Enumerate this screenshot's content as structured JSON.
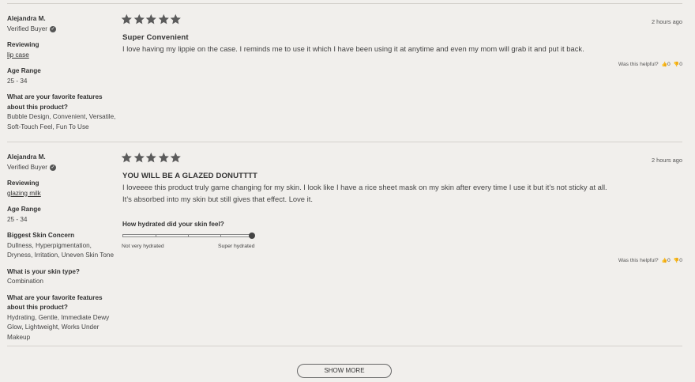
{
  "reviews": [
    {
      "author": "Alejandra M.",
      "badge": "Verified Buyer",
      "rating": 5,
      "date": "2 hours ago",
      "title": "Super Convenient",
      "body_lines": [
        "I love having my lippie on the case. I reminds me to use it which I have been using it at anytime and even my mom will grab it and put it back."
      ],
      "reviewing_label": "Reviewing",
      "reviewing": "lip case",
      "age_label": "Age Range",
      "age": "25 - 34",
      "features_label_lines": [
        "What are your favorite features",
        "about this product?"
      ],
      "features_lines": [
        "Bubble Design, Convenient, Versatile,",
        "Soft-Touch Feel, Fun To Use"
      ],
      "helpful_label": "Was this helpful?",
      "helpful_yes": "0",
      "helpful_no": "0"
    },
    {
      "author": "Alejandra M.",
      "badge": "Verified Buyer",
      "rating": 5,
      "date": "2 hours ago",
      "title": "YOU WILL BE A GLAZED DONUTTTT",
      "body_lines": [
        "I loveeee this product truly game changing for my skin. I look like I have a rice sheet mask on my skin after every time I use it but it’s not sticky at all.",
        "It’s absorbed into my skin but still gives that effect. Love it."
      ],
      "reviewing_label": "Reviewing",
      "reviewing": "glazing milk",
      "age_label": "Age Range",
      "age": "25 - 34",
      "concern_label": "Biggest Skin Concern",
      "concern_lines": [
        "Dullness, Hyperpigmentation,",
        "Dryness, Irritation, Uneven Skin Tone"
      ],
      "skin_type_label": "What is your skin type?",
      "skin_type": "Combination",
      "features_label_lines": [
        "What are your favorite features",
        "about this product?"
      ],
      "features_lines": [
        "Hydrating, Gentle, Immediate Dewy",
        "Glow, Lightweight, Works Under",
        "Makeup"
      ],
      "slider": {
        "question": "How hydrated did your skin feel?",
        "min_label": "Not very hydrated",
        "max_label": "Super hydrated",
        "value_fraction": 1.0
      },
      "helpful_label": "Was this helpful?",
      "helpful_yes": "0",
      "helpful_no": "0"
    }
  ],
  "show_more_label": "SHOW MORE",
  "colors": {
    "star": "#5b5b5b",
    "background": "#f1efec",
    "rule": "#d4d1cc"
  },
  "icons": {
    "verified": "check-circle-icon",
    "helpful_yes": "thumbs-up-icon",
    "helpful_no": "thumbs-down-icon",
    "rating": "star-icon"
  }
}
